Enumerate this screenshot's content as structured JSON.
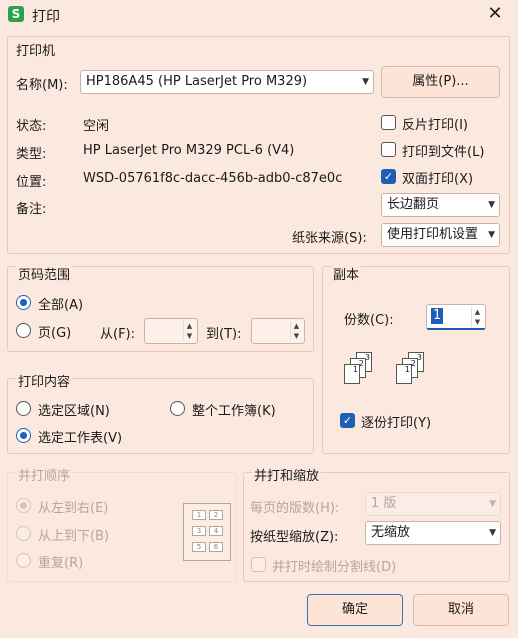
{
  "window": {
    "title": "打印",
    "app_icon_letter": "S",
    "close_glyph": "✕"
  },
  "printer": {
    "group_title": "打印机",
    "name_label": "名称(M):",
    "name_value": "HP186A45 (HP LaserJet Pro M329)",
    "properties_button": "属性(P)...",
    "status_label": "状态:",
    "status_value": "空闲",
    "type_label": "类型:",
    "type_value": "HP LaserJet Pro M329 PCL-6 (V4)",
    "location_label": "位置:",
    "location_value": "WSD-05761f8c-dacc-456b-adb0-c87e0c",
    "note_label": "备注:",
    "reverse_print": "反片打印(I)",
    "print_to_file": "打印到文件(L)",
    "duplex_print": "双面打印(X)",
    "flip_option": "长边翻页",
    "paper_source_label": "纸张来源(S):",
    "paper_source_value": "使用打印机设置"
  },
  "page_range": {
    "group_title": "页码范围",
    "all": "全部(A)",
    "pages": "页(G)",
    "from_label": "从(F):",
    "to_label": "到(T):"
  },
  "copies": {
    "group_title": "副本",
    "count_label": "份数(C):",
    "count_value": "1",
    "collate": "逐份打印(Y)"
  },
  "print_content": {
    "group_title": "打印内容",
    "selection": "选定区域(N)",
    "entire_workbook": "整个工作簿(K)",
    "active_sheet": "选定工作表(V)"
  },
  "print_order": {
    "group_title": "并打顺序",
    "left_to_right": "从左到右(E)",
    "top_to_bottom": "从上到下(B)",
    "repeat": "重复(R)"
  },
  "scaling": {
    "group_title": "并打和缩放",
    "pages_per_sheet_label": "每页的版数(H):",
    "pages_per_sheet_value": "1 版",
    "scale_label": "按纸型缩放(Z):",
    "scale_value": "无缩放",
    "draw_borders": "并打时绘制分割线(D)"
  },
  "footer": {
    "ok": "确定",
    "cancel": "取消"
  }
}
